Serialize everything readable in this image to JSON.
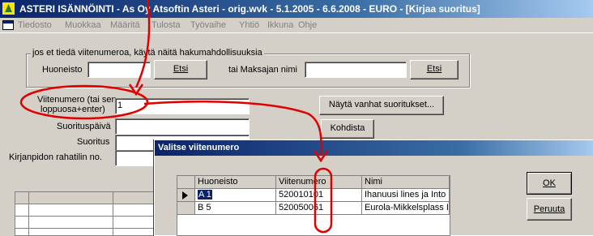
{
  "window": {
    "title": "ASTERI ISÄNNÖINTI - As Oy Atsoftin Asteri - orig.wvk - 5.1.2005 - 6.6.2008 - EURO - [Kirjaa suoritus]"
  },
  "menu": {
    "items": [
      "Tiedosto",
      "Muokkaa",
      "Määritä",
      "Tulosta",
      "Työvaihe",
      "Yhtiö",
      "Ikkuna",
      "Ohje"
    ]
  },
  "search_group": {
    "legend": "jos et tiedä viitenumeroa, käytä näitä hakumahdollisuuksia",
    "huoneisto_label": "Huoneisto",
    "huoneisto_value": "",
    "etsi1_label": "Etsi",
    "maksaja_label": "tai Maksajan nimi",
    "maksaja_value": "",
    "etsi2_label": "Etsi"
  },
  "form": {
    "viitenumero_label_line1": "Viitenumero (tai sen",
    "viitenumero_label_line2": "loppuosa+enter)",
    "viitenumero_value": "1",
    "suorituspaiva_label": "Suorituspäivä",
    "suoritus_label": "Suoritus",
    "rahatili_label": "Kirjanpidon rahatilin no."
  },
  "buttons": {
    "nayta_vanhat": "Näytä vanhat suoritukset...",
    "kohdista": "Kohdista"
  },
  "dialog": {
    "title": "Valitse viitenumero",
    "columns": [
      "Huoneisto",
      "Viitenumero",
      "Nimi"
    ],
    "rows": [
      {
        "huoneisto": "A 1",
        "viitenumero": "520010101",
        "nimi": "Ihanuusi lines ja Into",
        "selected": true
      },
      {
        "huoneisto": "B 5",
        "viitenumero": "520050061",
        "nimi": "Eurola-Mikkelsplass I",
        "selected": false
      }
    ],
    "ok_label": "OK",
    "cancel_label": "Peruuta"
  },
  "annotation": {
    "color": "#e00000"
  }
}
